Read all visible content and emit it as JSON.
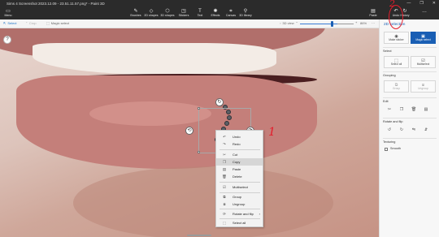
{
  "window": {
    "title": "Sims 4 Screenshot 2023.12.09 - 23.51.11.57.png* - Paint 3D",
    "controls": [
      "—",
      "❐",
      "✕"
    ]
  },
  "ribbon": {
    "menu": {
      "label": "Menu",
      "icon": "folder-icon"
    },
    "tools": [
      {
        "label": "Brushes",
        "icon": "brush-icon"
      },
      {
        "label": "2D shapes",
        "icon": "shapes-2d-icon"
      },
      {
        "label": "3D shapes",
        "icon": "shapes-3d-icon"
      },
      {
        "label": "Stickers",
        "icon": "sticker-icon"
      },
      {
        "label": "Text",
        "icon": "text-icon"
      },
      {
        "label": "Effects",
        "icon": "effects-icon"
      },
      {
        "label": "Canvas",
        "icon": "canvas-icon"
      },
      {
        "label": "3D library",
        "icon": "library-3d-icon"
      }
    ],
    "right": [
      {
        "label": "Paste",
        "icon": "paste-icon"
      },
      {
        "label": "Undo",
        "icon": "undo-icon"
      },
      {
        "label": "History",
        "icon": "history-icon"
      },
      {
        "label": "…",
        "icon": "more-icon"
      }
    ]
  },
  "toolbar": {
    "select": "Select",
    "crop": "Crop",
    "magic_select": "Magic select",
    "view_3d": "3D view",
    "zoom": "86%",
    "zoom_fraction": 0.64
  },
  "canvas": {
    "help": "?",
    "annotation_1": "1",
    "annotation_2": "2"
  },
  "context_menu": {
    "items": [
      {
        "label": "Undo",
        "icon": "undo-icon",
        "highlighted": false
      },
      {
        "label": "Redo",
        "icon": "redo-icon",
        "highlighted": false
      },
      {
        "label": "Cut",
        "icon": "cut-icon",
        "highlighted": false
      },
      {
        "label": "Copy",
        "icon": "copy-icon",
        "highlighted": true
      },
      {
        "label": "Paste",
        "icon": "paste-icon",
        "highlighted": false
      },
      {
        "label": "Delete",
        "icon": "delete-icon",
        "highlighted": false
      },
      {
        "label": "Multiselect",
        "icon": "multiselect-icon",
        "highlighted": false
      },
      {
        "label": "Group",
        "icon": "group-icon",
        "highlighted": false
      },
      {
        "label": "Ungroup",
        "icon": "ungroup-icon",
        "highlighted": false
      },
      {
        "label": "Rotate and flip",
        "icon": "rotate-icon",
        "highlighted": false
      },
      {
        "label": "Select all",
        "icon": "select-all-icon",
        "highlighted": false
      }
    ]
  },
  "panel": {
    "title": "2D selection",
    "make_sticker": "Make sticker",
    "magic_select": "Magic select",
    "select_heading": "Select",
    "select_all": "Select all",
    "multiselect": "Multiselect",
    "grouping_heading": "Grouping",
    "group": "Group",
    "ungroup": "Ungroup",
    "edit_heading": "Edit",
    "rotate_heading": "Rotate and flip",
    "texturing_heading": "Texturing",
    "smooth": "Smooth"
  }
}
